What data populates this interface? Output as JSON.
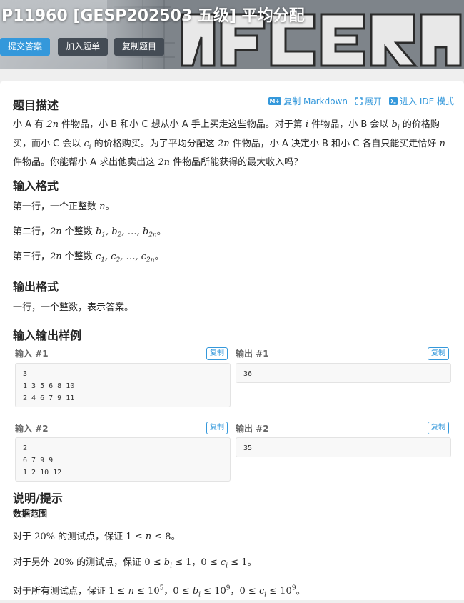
{
  "header": {
    "title": "P11960 [GESP202503 五级] 平均分配",
    "buttons": {
      "submit": "提交答案",
      "add_to_list": "加入题单",
      "copy_problem": "复制题目"
    }
  },
  "toolbar": {
    "copy_markdown": "复制 Markdown",
    "expand": "展开",
    "ide_mode": "进入 IDE 模式",
    "markdown_icon": "M↓"
  },
  "sections": {
    "description": {
      "heading": "题目描述",
      "text_parts": [
        "小 A 有 ",
        "2n",
        " 件物品，小 B 和小 C 想从小 A 手上买走这些物品。对于第 ",
        "i",
        " 件物品，小 B 会以 ",
        "b",
        "i",
        " 的价格购买，而小 C 会以 ",
        "c",
        "i",
        " 的价格购买。为了平均分配这 ",
        "2n",
        " 件物品，小 A 决定小 B 和小 C 各自只能买走恰好 ",
        "n",
        " 件物品。你能帮小 A 求出他卖出这 ",
        "2n",
        " 件物品所能获得的最大收入吗？"
      ]
    },
    "input_format": {
      "heading": "输入格式",
      "line1_prefix": "第一行，一个正整数 ",
      "line1_var": "n",
      "line2_prefix": "第二行，",
      "line2_mid": " 个整数 ",
      "line3_prefix": "第三行，",
      "line3_mid": " 个整数 "
    },
    "output_format": {
      "heading": "输出格式",
      "text": "一行，一个整数，表示答案。"
    },
    "samples": {
      "heading": "输入输出样例",
      "copy_label": "复制",
      "items": [
        {
          "input_label": "输入 #1",
          "output_label": "输出 #1",
          "input": "3\n1 3 5 6 8 10\n2 4 6 7 9 11",
          "output": "36"
        },
        {
          "input_label": "输入 #2",
          "output_label": "输出 #2",
          "input": "2\n6 7 9 9\n1 2 10 12",
          "output": "35"
        }
      ]
    },
    "hint": {
      "heading": "说明/提示",
      "subheading": "数据范围",
      "line1_prefix": "对于 ",
      "line1_pct": "20%",
      "line1_mid": " 的测试点，保证 ",
      "line2_prefix": "对于另外 ",
      "line2_pct": "20%",
      "line2_mid": " 的测试点，保证 ",
      "line3_prefix": "对于所有测试点，保证 "
    }
  },
  "colors": {
    "accent": "#3498db",
    "dark_button": "#444c55"
  }
}
